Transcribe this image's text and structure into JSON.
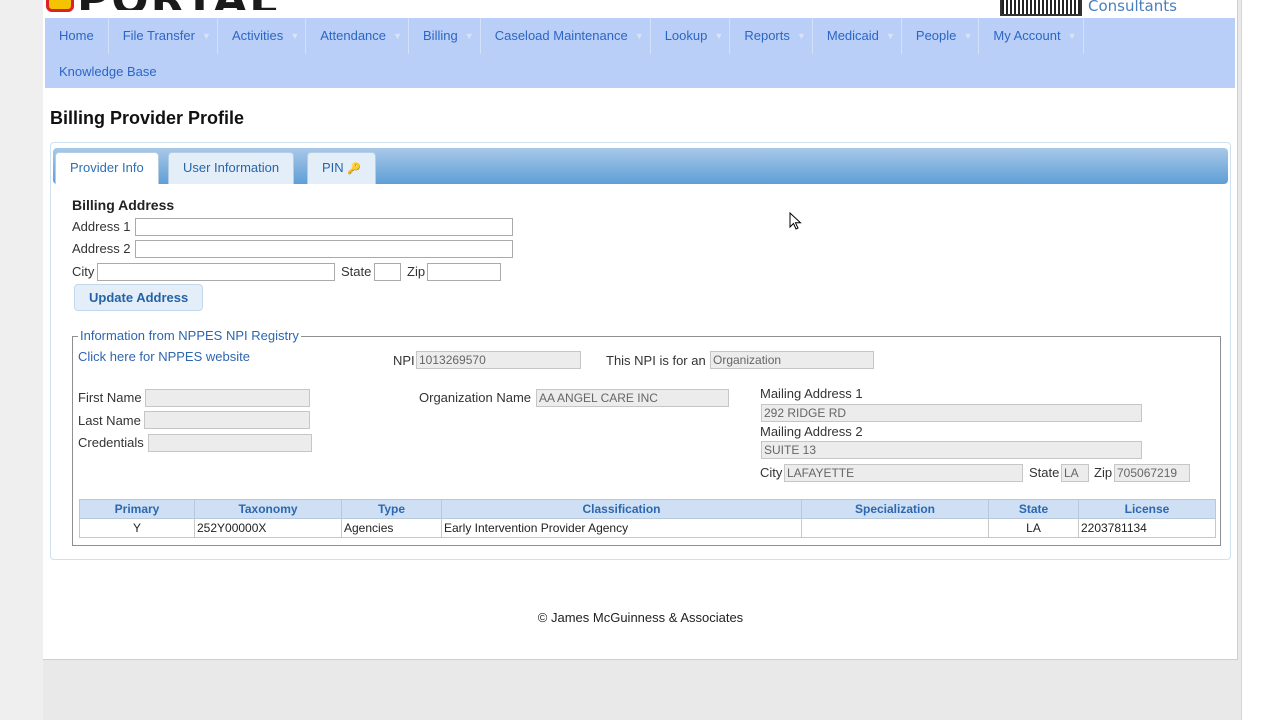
{
  "header": {
    "logo_text": "PORTAL",
    "consultants_text": "Consultants"
  },
  "nav": {
    "items": [
      {
        "label": "Home",
        "dropdown": false
      },
      {
        "label": "File Transfer",
        "dropdown": true
      },
      {
        "label": "Activities",
        "dropdown": true
      },
      {
        "label": "Attendance",
        "dropdown": true
      },
      {
        "label": "Billing",
        "dropdown": true
      },
      {
        "label": "Caseload Maintenance",
        "dropdown": true
      },
      {
        "label": "Lookup",
        "dropdown": true
      },
      {
        "label": "Reports",
        "dropdown": true
      },
      {
        "label": "Medicaid",
        "dropdown": true
      },
      {
        "label": "People",
        "dropdown": true
      },
      {
        "label": "My Account",
        "dropdown": true
      }
    ],
    "row2": {
      "label": "Knowledge Base"
    }
  },
  "page_title": "Billing Provider Profile",
  "tabs": [
    {
      "label": "Provider Info",
      "active": true
    },
    {
      "label": "User Information",
      "active": false
    },
    {
      "label": "PIN",
      "active": false,
      "icon": "key-icon"
    }
  ],
  "billing_address": {
    "heading": "Billing Address",
    "address1_label": "Address 1",
    "address1_value": "",
    "address2_label": "Address 2",
    "address2_value": "",
    "city_label": "City",
    "city_value": "",
    "state_label": "State",
    "state_value": "",
    "zip_label": "Zip",
    "zip_value": "",
    "update_button": "Update Address"
  },
  "nppes": {
    "legend": "Information from NPPES NPI Registry",
    "link": "Click here for NPPES website",
    "npi_label": "NPI",
    "npi_value": "1013269570",
    "npi_type_label": "This NPI is for an",
    "npi_type_value": "Organization",
    "first_name_label": "First Name",
    "first_name_value": "",
    "last_name_label": "Last Name",
    "last_name_value": "",
    "credentials_label": "Credentials",
    "credentials_value": "",
    "org_name_label": "Organization Name",
    "org_name_value": "AA ANGEL CARE INC",
    "mailing1_label": "Mailing Address 1",
    "mailing1_value": "292 RIDGE RD",
    "mailing2_label": "Mailing Address 2",
    "mailing2_value": "SUITE 13",
    "city_label": "City",
    "city_value": "LAFAYETTE",
    "state_label": "State",
    "state_value": "LA",
    "zip_label": "Zip",
    "zip_value": "705067219"
  },
  "taxonomy_table": {
    "headers": [
      "Primary",
      "Taxonomy",
      "Type",
      "Classification",
      "Specialization",
      "State",
      "License"
    ],
    "rows": [
      [
        "Y",
        "252Y00000X",
        "Agencies",
        "Early Intervention Provider Agency",
        "",
        "LA",
        "2203781134"
      ]
    ]
  },
  "footer": "© James McGuinness & Associates",
  "colors": {
    "nav_bg": "#b9cff7",
    "nav_text": "#2c66c4",
    "tabbar": "#5f9ed6",
    "table_header_bg": "#cfe0f4"
  }
}
